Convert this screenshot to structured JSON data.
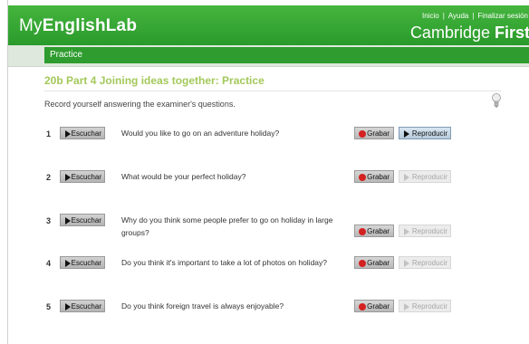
{
  "header": {
    "brand_part1": "My",
    "brand_part2": "EnglishLab",
    "links": [
      "Inicio",
      "Ayuda",
      "Finalizar sesión"
    ],
    "link_separator": "|",
    "product_part1": "Cambridge ",
    "product_part2": "First"
  },
  "subnav": {
    "label": "Practice"
  },
  "activity": {
    "title": "20b Part 4 Joining ideas together: Practice",
    "instruction": "Record yourself answering the examiner's questions."
  },
  "questions": [
    {
      "number": "1",
      "listen_label": "Escuchar",
      "text": "Would you like to go on an adventure holiday?",
      "record_label": "Grabar",
      "play_label": "Reproducir",
      "play_enabled": true
    },
    {
      "number": "2",
      "listen_label": "Escuchar",
      "text": "What would be your perfect holiday?",
      "record_label": "Grabar",
      "play_label": "Reproducir",
      "play_enabled": false
    },
    {
      "number": "3",
      "listen_label": "Escuchar",
      "text": "Why do you think some people prefer to go on holiday in large groups?",
      "record_label": "Grabar",
      "play_label": "Reproducir",
      "play_enabled": false
    },
    {
      "number": "4",
      "listen_label": "Escuchar",
      "text": "Do you think it's important to take a lot of photos on holiday?",
      "record_label": "Grabar",
      "play_label": "Reproducir",
      "play_enabled": false
    },
    {
      "number": "5",
      "listen_label": "Escuchar",
      "text": "Do you think foreign travel is always enjoyable?",
      "record_label": "Grabar",
      "play_label": "Reproducir",
      "play_enabled": false
    }
  ],
  "colors": {
    "header_green": "#2a9a2b",
    "title_green": "#a3c85a",
    "record_dot": "#d42121"
  }
}
